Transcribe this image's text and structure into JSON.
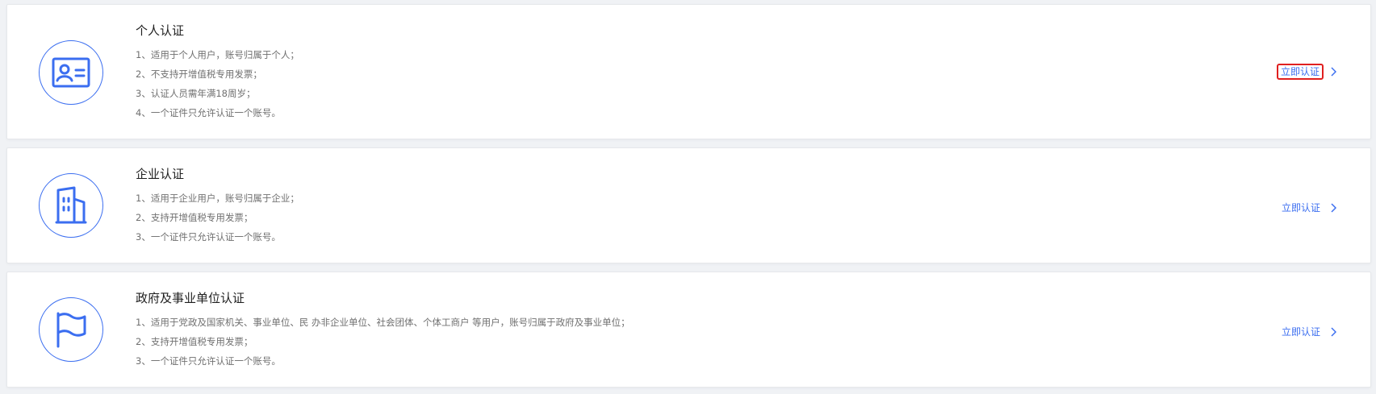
{
  "colors": {
    "accent": "#3b6ef0",
    "highlight_border": "#e02020",
    "background": "#f0f2f5"
  },
  "cards": [
    {
      "title": "个人认证",
      "icon": "id-card-icon",
      "lines": [
        "1、适用于个人用户，账号归属于个人；",
        "2、不支持开增值税专用发票；",
        "3、认证人员需年满18周岁；",
        "4、一个证件只允许认证一个账号。"
      ],
      "action_label": "立即认证"
    },
    {
      "title": "企业认证",
      "icon": "building-icon",
      "lines": [
        "1、适用于企业用户，账号归属于企业；",
        "2、支持开增值税专用发票；",
        "3、一个证件只允许认证一个账号。"
      ],
      "action_label": "立即认证"
    },
    {
      "title": "政府及事业单位认证",
      "icon": "flag-icon",
      "lines": [
        "1、适用于党政及国家机关、事业单位、民 办非企业单位、社会团体、个体工商户 等用户，账号归属于政府及事业单位；",
        "2、支持开增值税专用发票；",
        "3、一个证件只允许认证一个账号。"
      ],
      "action_label": "立即认证"
    }
  ]
}
